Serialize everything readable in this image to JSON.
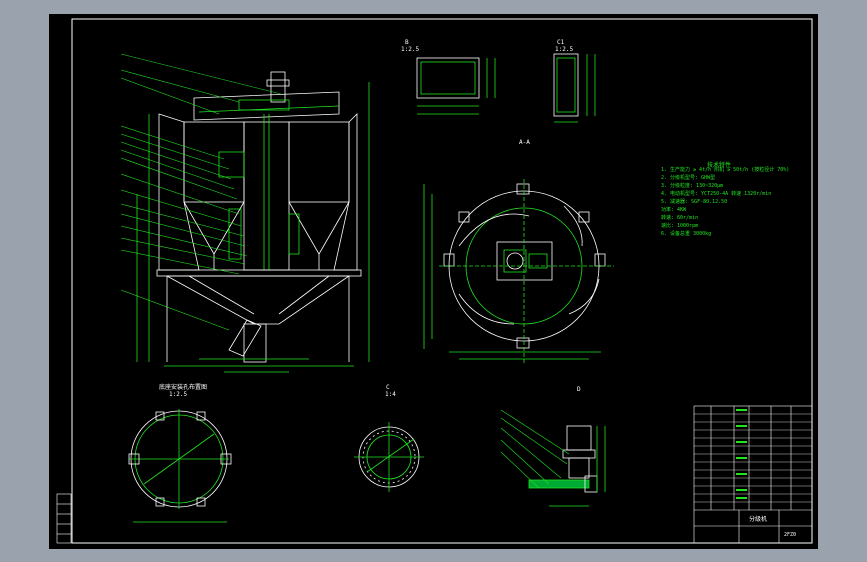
{
  "drawing": {
    "view_labels": {
      "section_a": "A-A",
      "section_b": "B",
      "section_c": "C",
      "detail_c1": "C1",
      "detail_d": "D",
      "bottom_left": "底座安装孔布置图"
    },
    "scales": {
      "b": "1:2.5",
      "c1": "1:2.5",
      "bottom_left": "1:2.5",
      "c": "1:4"
    },
    "notes_title": "技术特性",
    "notes": [
      "1. 生产能力 ≥ 4t/h  附机 ≥ 50t/h  (按粒径计 70%)",
      "2. 分级机型号: GHW型",
      "3. 分级粒度: 130~320μm",
      "4. 电动机型号: YCT250-4A  转速 1320r/min",
      "5. 减速器: SGF-80.12.50",
      "   功率: 4KW",
      "   转速: 60r/min",
      "   速比: 1000rpm",
      "6. 设备总重 3000kg"
    ],
    "title_block": {
      "drawing_title": "分级机",
      "drawing_no": "2FZ0"
    },
    "colors": {
      "background": "#000000",
      "outline": "#ffffff",
      "dimension": "#21e321",
      "accent": "#00ffff"
    }
  }
}
